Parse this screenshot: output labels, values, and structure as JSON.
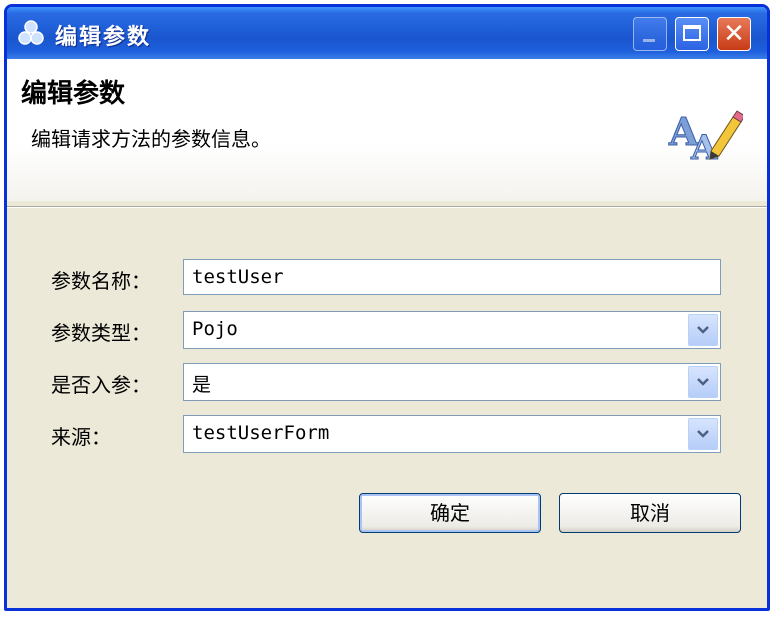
{
  "window": {
    "title": "编辑参数",
    "controls": [
      "minimize-icon",
      "maximize-icon",
      "close-icon"
    ],
    "close_glyph": "✕"
  },
  "header": {
    "title": "编辑参数",
    "description": "编辑请求方法的参数信息。",
    "icon": "font-edit-icon"
  },
  "form": {
    "param_name": {
      "label": "参数名称：",
      "value": "testUser"
    },
    "param_type": {
      "label": "参数类型：",
      "value": "Pojo"
    },
    "is_input": {
      "label": "是否入参：",
      "value": "是"
    },
    "source": {
      "label": "来源：",
      "value": "testUserForm"
    }
  },
  "buttons": {
    "ok": "确定",
    "cancel": "取消"
  },
  "colors": {
    "titlebar": "#1f5fd8",
    "window_border": "#0831d9",
    "dialog_bg": "#ece9d8",
    "close_button": "#c73b16",
    "field_border": "#7f9db9"
  }
}
